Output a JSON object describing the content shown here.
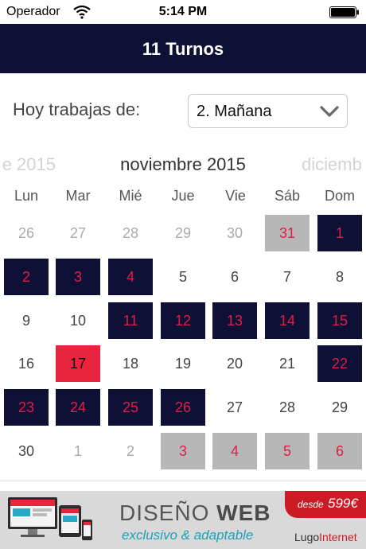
{
  "status_bar": {
    "carrier": "Operador",
    "time": "5:14 PM"
  },
  "header": {
    "title": "11 Turnos"
  },
  "shift": {
    "label": "Hoy trabajas de:",
    "selected": "2. Mañana"
  },
  "months": {
    "previous": "e 2015",
    "current": "noviembre 2015",
    "next": "diciemb"
  },
  "weekdays": [
    "Lun",
    "Mar",
    "Mié",
    "Jue",
    "Vie",
    "Sáb",
    "Dom"
  ],
  "calendar": {
    "colors": {
      "shift_day": "#0e1036",
      "today": "#e8243f",
      "other_month_shift": "#b7b7b7",
      "day_number_accent": "#e21d45"
    },
    "weeks": [
      [
        {
          "day": "26",
          "state": "faded"
        },
        {
          "day": "27",
          "state": "faded"
        },
        {
          "day": "28",
          "state": "faded"
        },
        {
          "day": "29",
          "state": "faded"
        },
        {
          "day": "30",
          "state": "faded"
        },
        {
          "day": "31",
          "state": "gray"
        },
        {
          "day": "1",
          "state": "navy"
        }
      ],
      [
        {
          "day": "2",
          "state": "navy"
        },
        {
          "day": "3",
          "state": "navy"
        },
        {
          "day": "4",
          "state": "navy"
        },
        {
          "day": "5",
          "state": "plain"
        },
        {
          "day": "6",
          "state": "plain"
        },
        {
          "day": "7",
          "state": "plain"
        },
        {
          "day": "8",
          "state": "plain"
        }
      ],
      [
        {
          "day": "9",
          "state": "plain"
        },
        {
          "day": "10",
          "state": "plain"
        },
        {
          "day": "11",
          "state": "navy"
        },
        {
          "day": "12",
          "state": "navy"
        },
        {
          "day": "13",
          "state": "navy"
        },
        {
          "day": "14",
          "state": "navy"
        },
        {
          "day": "15",
          "state": "navy"
        }
      ],
      [
        {
          "day": "16",
          "state": "plain"
        },
        {
          "day": "17",
          "state": "red"
        },
        {
          "day": "18",
          "state": "plain"
        },
        {
          "day": "19",
          "state": "plain"
        },
        {
          "day": "20",
          "state": "plain"
        },
        {
          "day": "21",
          "state": "plain"
        },
        {
          "day": "22",
          "state": "navy"
        }
      ],
      [
        {
          "day": "23",
          "state": "navy"
        },
        {
          "day": "24",
          "state": "navy"
        },
        {
          "day": "25",
          "state": "navy"
        },
        {
          "day": "26",
          "state": "navy"
        },
        {
          "day": "27",
          "state": "plain"
        },
        {
          "day": "28",
          "state": "plain"
        },
        {
          "day": "29",
          "state": "plain"
        }
      ],
      [
        {
          "day": "30",
          "state": "plain"
        },
        {
          "day": "1",
          "state": "faded"
        },
        {
          "day": "2",
          "state": "faded"
        },
        {
          "day": "3",
          "state": "gray"
        },
        {
          "day": "4",
          "state": "gray"
        },
        {
          "day": "5",
          "state": "gray"
        },
        {
          "day": "6",
          "state": "gray"
        }
      ]
    ]
  },
  "ad": {
    "title_left": "DISEÑO",
    "title_right": "WEB",
    "subtitle": "exclusivo & adaptable",
    "price_prefix": "desde",
    "price": "599€",
    "brand_left": "Lugo",
    "brand_right": "Internet",
    "icon": "devices-icon"
  }
}
